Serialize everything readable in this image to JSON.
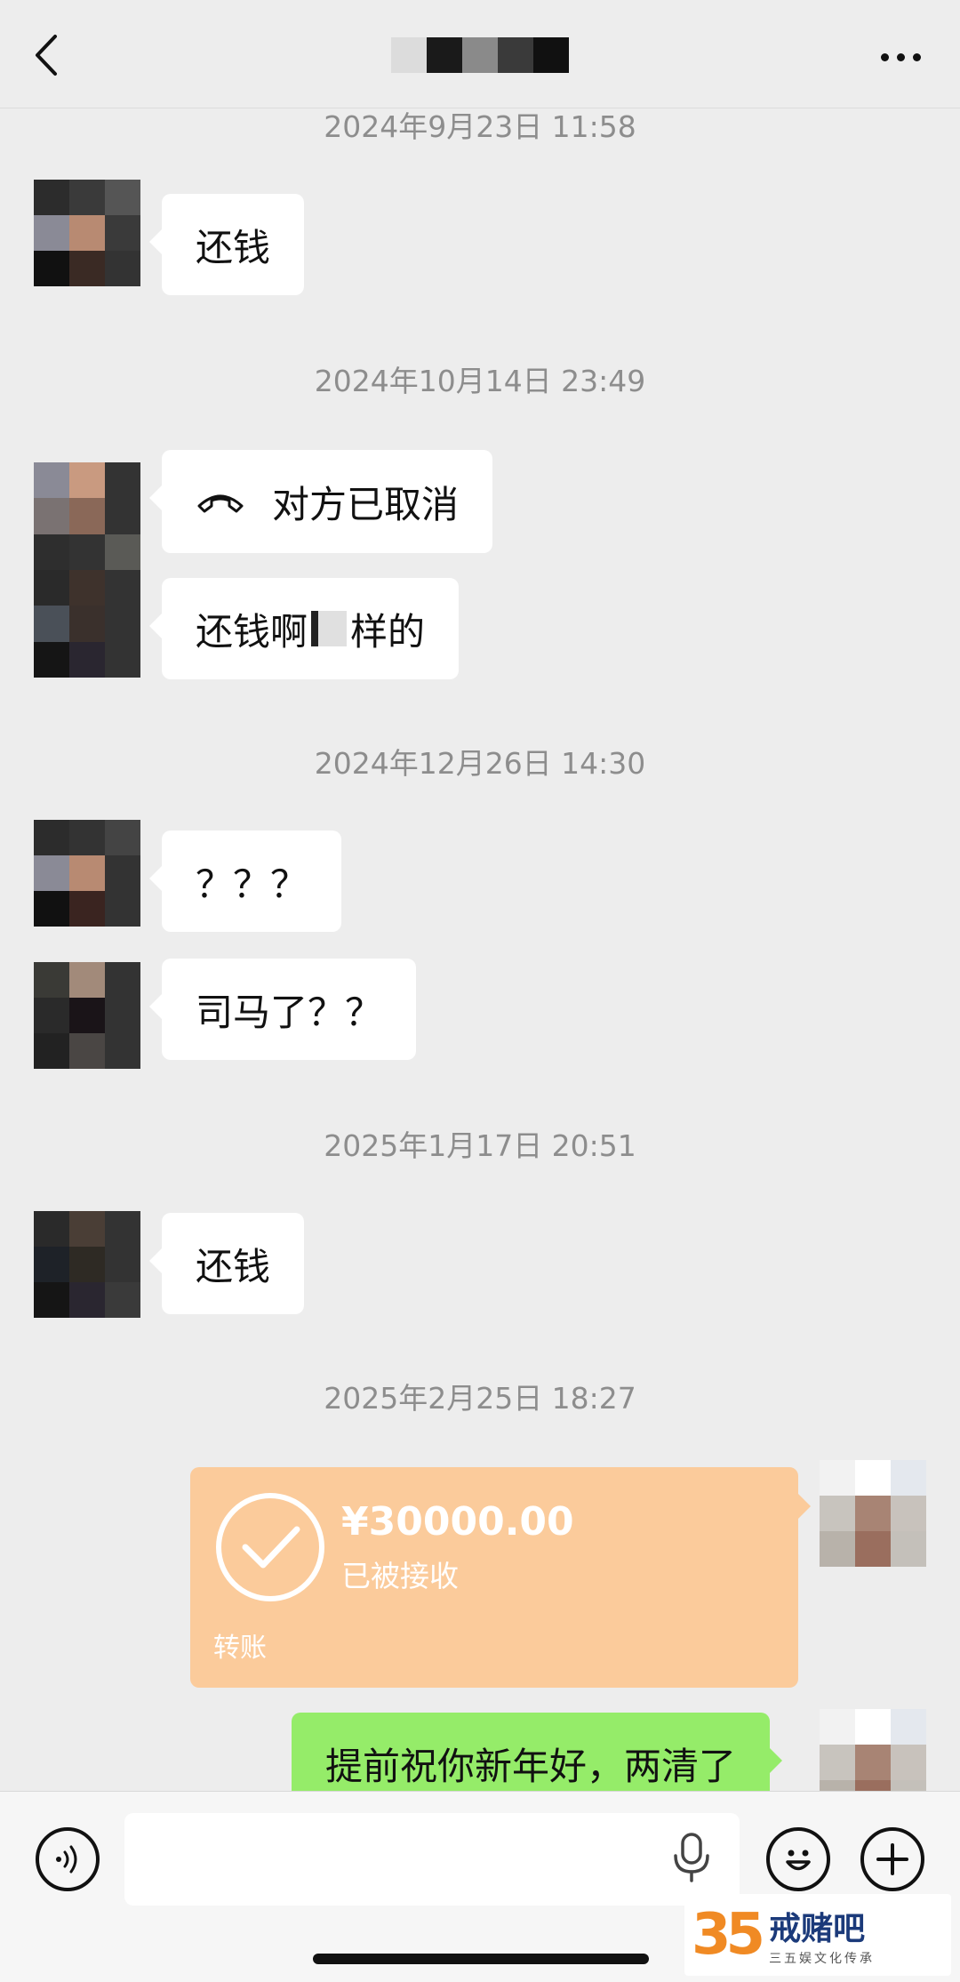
{
  "header": {
    "title_redacted": true
  },
  "messages": [
    {
      "timestamp": "2024年9月23日 11:58",
      "bubbles": [
        {
          "text": "还钱"
        }
      ]
    },
    {
      "timestamp": "2024年10月14日 23:49",
      "bubbles": [
        {
          "text": "对方已取消",
          "type": "voice-call"
        },
        {
          "text_before": "还钱啊",
          "text_after": "样的"
        }
      ]
    },
    {
      "timestamp": "2024年12月26日 14:30",
      "bubbles": [
        {
          "text": "？？？"
        },
        {
          "text": "司马了？？"
        }
      ]
    },
    {
      "timestamp": "2025年1月17日 20:51",
      "bubbles": [
        {
          "text": "还钱"
        }
      ]
    },
    {
      "timestamp": "2025年2月25日 18:27"
    }
  ],
  "transfer": {
    "amount": "¥30000.00",
    "status": "已被接收",
    "label": "转账"
  },
  "outgoing": {
    "text": "提前祝你新年好，两清了"
  },
  "watermark": {
    "number": "35",
    "main": "戒赌吧",
    "sub": "三五娱文化传承"
  },
  "colors": {
    "background": "#ededed",
    "bubble_green": "#95ec69",
    "transfer_orange": "#fbcb9b",
    "timestamp": "#8d8d8d"
  },
  "icons": {
    "back": "chevron-left-icon",
    "more": "more-dots-icon",
    "voice": "voice-mode-icon",
    "mic": "microphone-icon",
    "emoji": "emoji-icon",
    "add": "plus-icon",
    "call": "hangup-phone-icon",
    "check": "check-circle-icon"
  }
}
